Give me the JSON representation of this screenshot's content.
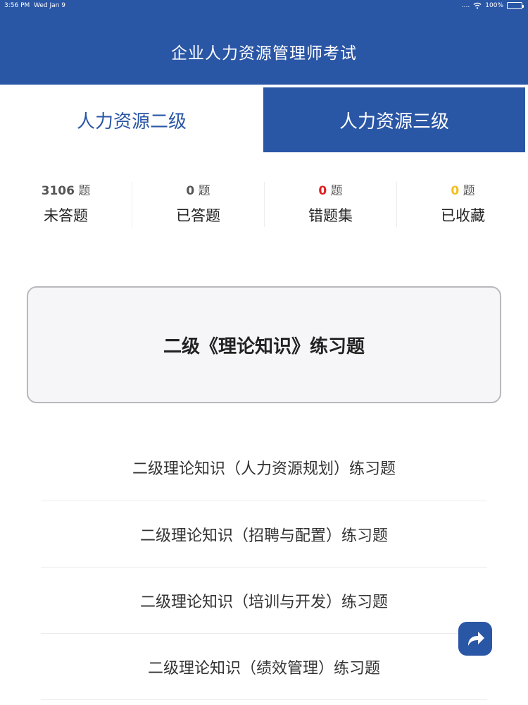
{
  "status_bar": {
    "time": "3:56 PM",
    "date": "Wed Jan 9",
    "signal": "....",
    "battery": "100%"
  },
  "header": {
    "title": "企业人力资源管理师考试"
  },
  "tabs": [
    {
      "label": "人力资源二级",
      "selected": true
    },
    {
      "label": "人力资源三级",
      "selected": false
    }
  ],
  "stats": [
    {
      "count": "3106",
      "unit": "题",
      "label": "未答题",
      "color": "#555555"
    },
    {
      "count": "0",
      "unit": "题",
      "label": "已答题",
      "color": "#555555"
    },
    {
      "count": "0",
      "unit": "题",
      "label": "错题集",
      "color": "#e02020"
    },
    {
      "count": "0",
      "unit": "题",
      "label": "已收藏",
      "color": "#f2c01e"
    }
  ],
  "main_card": {
    "label": "二级《理论知识》练习题"
  },
  "list": [
    {
      "label": "二级理论知识（人力资源规划）练习题"
    },
    {
      "label": "二级理论知识（招聘与配置）练习题"
    },
    {
      "label": "二级理论知识（培训与开发）练习题"
    },
    {
      "label": "二级理论知识（绩效管理）练习题"
    }
  ],
  "colors": {
    "primary": "#2a56a6",
    "wrong": "#e02020",
    "favorite": "#f2c01e"
  },
  "icons": {
    "share": "share-arrow-icon",
    "wifi": "wifi-icon",
    "battery": "battery-icon"
  }
}
